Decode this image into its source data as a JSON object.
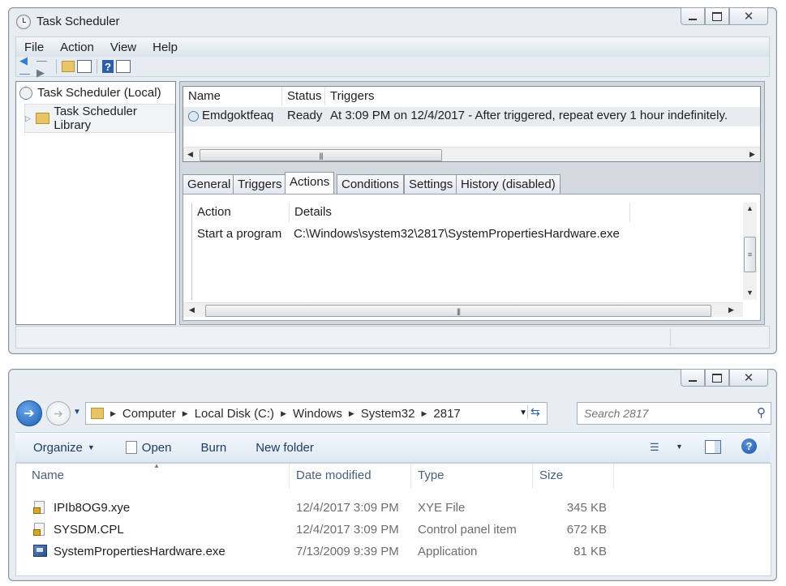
{
  "task_scheduler": {
    "title": "Task Scheduler",
    "menu": [
      "File",
      "Action",
      "View",
      "Help"
    ],
    "tree": {
      "root": "Task Scheduler (Local)",
      "child": "Task Scheduler Library"
    },
    "task_list": {
      "columns": [
        "Name",
        "Status",
        "Triggers"
      ],
      "rows": [
        {
          "name": "Emdgoktfeaq",
          "status": "Ready",
          "triggers": "At 3:09 PM on 12/4/2017 - After triggered, repeat every 1 hour indefinitely."
        }
      ]
    },
    "tabs": [
      "General",
      "Triggers",
      "Actions",
      "Conditions",
      "Settings",
      "History (disabled)"
    ],
    "active_tab": "Actions",
    "actions_table": {
      "columns": [
        "Action",
        "Details"
      ],
      "rows": [
        {
          "action": "Start a program",
          "details": "C:\\Windows\\system32\\2817\\SystemPropertiesHardware.exe"
        }
      ]
    }
  },
  "explorer": {
    "address": [
      "Computer",
      "Local Disk (C:)",
      "Windows",
      "System32",
      "2817"
    ],
    "search_placeholder": "Search 2817",
    "commands": {
      "organize": "Organize",
      "open": "Open",
      "burn": "Burn",
      "new_folder": "New folder"
    },
    "columns": [
      "Name",
      "Date modified",
      "Type",
      "Size"
    ],
    "files": [
      {
        "name": "IPIb8OG9.xye",
        "date": "12/4/2017 3:09 PM",
        "type": "XYE File",
        "size": "345 KB"
      },
      {
        "name": "SYSDM.CPL",
        "date": "12/4/2017 3:09 PM",
        "type": "Control panel item",
        "size": "672 KB"
      },
      {
        "name": "SystemPropertiesHardware.exe",
        "date": "7/13/2009 9:39 PM",
        "type": "Application",
        "size": "81 KB"
      }
    ]
  },
  "colors": {
    "window_frame": "#e8edf3",
    "accent_blue": "#1e5aa8",
    "status_text": "#6d6d6d"
  }
}
